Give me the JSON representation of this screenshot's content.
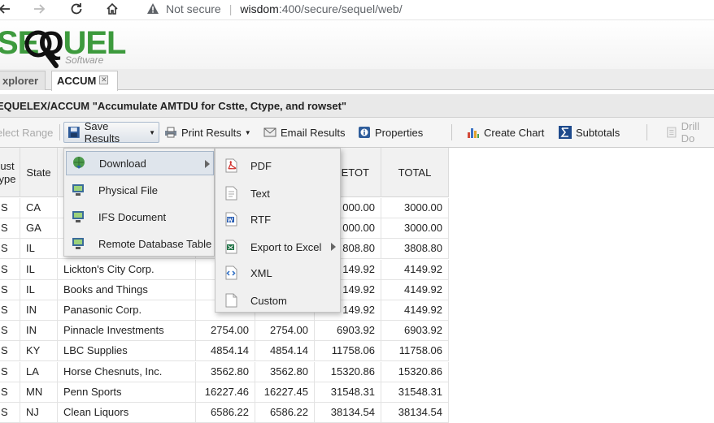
{
  "browser": {
    "security_label": "Not secure",
    "url_host": "wisdom",
    "url_rest": ":400/secure/sequel/web/"
  },
  "logo": {
    "text_se": "SE",
    "text_q": "Q",
    "text_uel": "UEL",
    "subtext": "Software"
  },
  "tabs": [
    {
      "label": "xplorer"
    },
    {
      "label": "ACCUM"
    }
  ],
  "title": "EQUELEX/ACCUM  \"Accumulate AMTDU for Cstte, Ctype, and rowset\"",
  "toolbar": {
    "select_range": "elect Range",
    "save_results": "Save Results",
    "print_results": "Print Results",
    "email_results": "Email Results",
    "properties": "Properties",
    "create_chart": "Create Chart",
    "subtotals": "Subtotals",
    "drill_down": "Drill Do"
  },
  "table": {
    "headers": [
      "ust\nype",
      "State",
      "",
      "",
      "",
      "ETOT",
      "TOTAL"
    ],
    "rows": [
      [
        "S",
        "CA",
        "",
        "",
        "",
        "000.00",
        "3000.00"
      ],
      [
        "S",
        "GA",
        "",
        "",
        "",
        "000.00",
        "3000.00"
      ],
      [
        "S",
        "IL",
        "",
        "",
        "",
        "808.80",
        "3808.80"
      ],
      [
        "S",
        "IL",
        "Lickton's City Corp.",
        "",
        "",
        "149.92",
        "4149.92"
      ],
      [
        "S",
        "IL",
        "Books and Things",
        "",
        "",
        "149.92",
        "4149.92"
      ],
      [
        "S",
        "IN",
        "Panasonic Corp.",
        "",
        "",
        "149.92",
        "4149.92"
      ],
      [
        "S",
        "IN",
        "Pinnacle Investments",
        "2754.00",
        "2754.00",
        "6903.92",
        "6903.92"
      ],
      [
        "S",
        "KY",
        "LBC Supplies",
        "4854.14",
        "4854.14",
        "11758.06",
        "11758.06"
      ],
      [
        "S",
        "LA",
        "Horse Chesnuts, Inc.",
        "3562.80",
        "3562.80",
        "15320.86",
        "15320.86"
      ],
      [
        "S",
        "MN",
        "Penn Sports",
        "16227.46",
        "16227.45",
        "31548.31",
        "31548.31"
      ],
      [
        "S",
        "NJ",
        "Clean Liquors",
        "6586.22",
        "6586.22",
        "38134.54",
        "38134.54"
      ]
    ]
  },
  "save_menu": {
    "items": [
      {
        "label": "Download"
      },
      {
        "label": "Physical File"
      },
      {
        "label": "IFS Document"
      },
      {
        "label": "Remote Database Table"
      }
    ]
  },
  "download_menu": {
    "items": [
      {
        "label": "PDF"
      },
      {
        "label": "Text"
      },
      {
        "label": "RTF"
      },
      {
        "label": "Export to Excel"
      },
      {
        "label": "XML"
      },
      {
        "label": "Custom"
      }
    ]
  },
  "colors": {
    "logo_green": "#3d9a3d",
    "menu_highlight": "#dfe5ec"
  }
}
